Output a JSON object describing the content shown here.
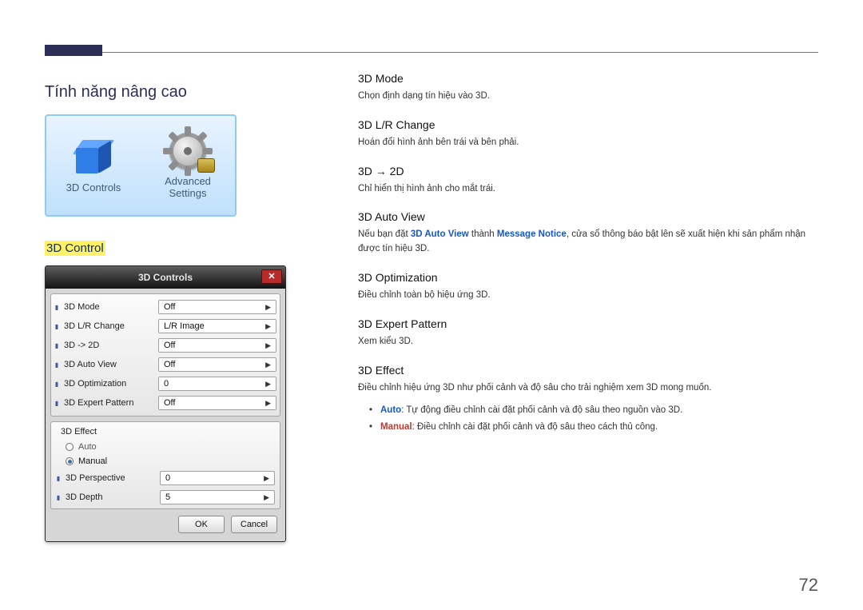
{
  "page_number": "72",
  "left": {
    "section_title": "Tính năng nâng cao",
    "icon_card": {
      "left_label": "3D Controls",
      "right_label_line1": "Advanced",
      "right_label_line2": "Settings"
    },
    "sub_section": "3D Control",
    "dialog": {
      "title": "3D Controls",
      "close": "✕",
      "rows": [
        {
          "label": "3D Mode",
          "value": "Off"
        },
        {
          "label": "3D L/R Change",
          "value": "L/R Image"
        },
        {
          "label": "3D -> 2D",
          "value": "Off"
        },
        {
          "label": "3D Auto View",
          "value": "Off"
        },
        {
          "label": "3D Optimization",
          "value": "0"
        },
        {
          "label": "3D Expert Pattern",
          "value": "Off"
        }
      ],
      "effect_group": {
        "title": "3D Effect",
        "radio_auto": "Auto",
        "radio_manual": "Manual",
        "selected": "Manual",
        "subrows": [
          {
            "label": "3D Perspective",
            "value": "0"
          },
          {
            "label": "3D Depth",
            "value": "5"
          }
        ]
      },
      "ok": "OK",
      "cancel": "Cancel"
    }
  },
  "right": {
    "items": [
      {
        "title": "3D Mode",
        "desc_plain": "Chọn định dạng tín hiệu vào 3D."
      },
      {
        "title": "3D L/R Change",
        "desc_plain": "Hoán đổi hình ảnh bên trái và bên phải."
      },
      {
        "title": "3D → 2D",
        "desc_plain": "Chỉ hiển thị hình ảnh cho mắt trái."
      },
      {
        "title": "3D Auto View",
        "pre": "Nếu bạn đặt ",
        "kw1": "3D Auto View",
        "mid": " thành ",
        "kw2": "Message Notice",
        "post": ", cửa sổ thông báo bật lên sẽ xuất hiện khi sản phẩm nhận được tín hiệu 3D."
      },
      {
        "title": "3D Optimization",
        "desc_plain": "Điều chỉnh toàn bộ hiệu ứng 3D."
      },
      {
        "title": "3D Expert Pattern",
        "desc_plain": "Xem kiểu 3D."
      },
      {
        "title": "3D Effect",
        "desc_plain": "Điều chỉnh hiệu ứng 3D như phối cảnh và độ sâu cho trải nghiệm xem 3D mong muốn.",
        "bullets": [
          {
            "kw": "Auto",
            "kw_class": "blue",
            "text": ": Tự động điều chỉnh cài đặt phối cảnh và độ sâu theo nguồn vào 3D."
          },
          {
            "kw": "Manual",
            "kw_class": "red",
            "text": ": Điều chỉnh cài đặt phối cảnh và độ sâu theo cách thủ công."
          }
        ]
      }
    ]
  }
}
